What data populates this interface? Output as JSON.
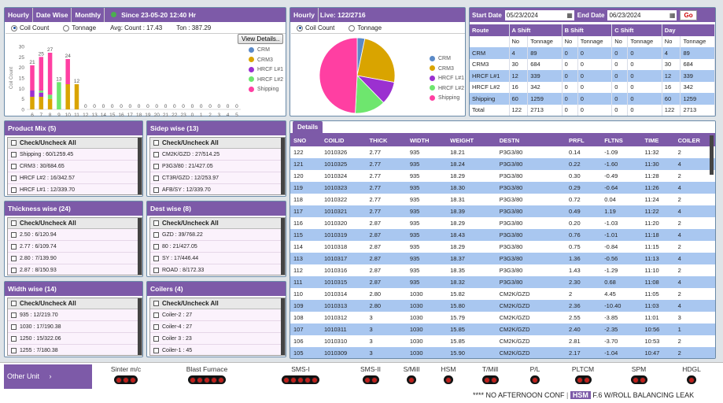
{
  "summary": {
    "tabs": [
      "Hourly",
      "Date Wise",
      "Monthly"
    ],
    "since": "Since 23-05-20 12:40 Hr",
    "coil_count_label": "Coil Count",
    "tonnage_label": "Tonnage",
    "avg_count": "Avg: Count : 17.43",
    "ton": "Ton : 387.29",
    "view_details": "View Details..",
    "legend": [
      {
        "name": "CRM",
        "color": "#5b8ac7"
      },
      {
        "name": "CRM3",
        "color": "#d9a400"
      },
      {
        "name": "HRCF L#1",
        "color": "#9b30d0"
      },
      {
        "name": "HRCF L#2",
        "color": "#6ee66e"
      },
      {
        "name": "Shipping",
        "color": "#ff3fa2"
      }
    ]
  },
  "chart_data": [
    {
      "type": "bar",
      "stacked": true,
      "ylabel": "Coil Count",
      "ylim": [
        0,
        30
      ],
      "yticks": [
        0,
        5,
        10,
        15,
        20,
        25,
        30
      ],
      "categories": [
        "6",
        "7",
        "8",
        "9",
        "10",
        "11",
        "12",
        "13",
        "14",
        "15",
        "16",
        "17",
        "18",
        "19",
        "20",
        "21",
        "22",
        "23",
        "0",
        "1",
        "2",
        "3",
        "4",
        "5"
      ],
      "labels": [
        21,
        25,
        27,
        13,
        24,
        12,
        0,
        0,
        0,
        0,
        0,
        0,
        0,
        0,
        0,
        0,
        0,
        0,
        0,
        0,
        0,
        0,
        0,
        0
      ],
      "series": [
        {
          "name": "CRM",
          "values": [
            0,
            0,
            0,
            0,
            0,
            0,
            0,
            0,
            0,
            0,
            0,
            0,
            0,
            0,
            0,
            0,
            0,
            0,
            0,
            0,
            0,
            0,
            0,
            0
          ]
        },
        {
          "name": "CRM3",
          "values": [
            6,
            6,
            5,
            0,
            12,
            12,
            0,
            0,
            0,
            0,
            0,
            0,
            0,
            0,
            0,
            0,
            0,
            0,
            0,
            0,
            0,
            0,
            0,
            0
          ]
        },
        {
          "name": "HRCF L#1",
          "values": [
            3,
            2,
            0,
            0,
            0,
            0,
            0,
            0,
            0,
            0,
            0,
            0,
            0,
            0,
            0,
            0,
            0,
            0,
            0,
            0,
            0,
            0,
            0,
            0
          ]
        },
        {
          "name": "HRCF L#2",
          "values": [
            0,
            1,
            2,
            13,
            0,
            0,
            0,
            0,
            0,
            0,
            0,
            0,
            0,
            0,
            0,
            0,
            0,
            0,
            0,
            0,
            0,
            0,
            0,
            0
          ]
        },
        {
          "name": "Shipping",
          "values": [
            12,
            16,
            20,
            0,
            12,
            0,
            0,
            0,
            0,
            0,
            0,
            0,
            0,
            0,
            0,
            0,
            0,
            0,
            0,
            0,
            0,
            0,
            0,
            0
          ]
        }
      ]
    },
    {
      "type": "pie",
      "slices": [
        {
          "name": "CRM",
          "value": 4
        },
        {
          "name": "CRM3",
          "value": 30
        },
        {
          "name": "HRCF L#1",
          "value": 12
        },
        {
          "name": "HRCF L#2",
          "value": 16
        },
        {
          "name": "Shipping",
          "value": 60
        }
      ]
    }
  ],
  "live": {
    "tabs": [
      "Hourly",
      "Live: 122/2716"
    ],
    "coil_count_label": "Coil Count",
    "tonnage_label": "Tonnage"
  },
  "shift": {
    "start_label": "Start Date",
    "start_value": "05/23/2024",
    "end_label": "End Date",
    "end_value": "06/23/2024",
    "go": "Go",
    "head1": [
      "Route",
      "A Shift",
      "B Shift",
      "C Shift",
      "Day"
    ],
    "head2": [
      "",
      "No",
      "Tonnage",
      "No",
      "Tonnage",
      "No",
      "Tonnage",
      "No",
      "Tonnage"
    ],
    "rows": [
      [
        "CRM",
        "4",
        "89",
        "0",
        "0",
        "0",
        "0",
        "4",
        "89"
      ],
      [
        "CRM3",
        "30",
        "684",
        "0",
        "0",
        "0",
        "0",
        "30",
        "684"
      ],
      [
        "HRCF L#1",
        "12",
        "339",
        "0",
        "0",
        "0",
        "0",
        "12",
        "339"
      ],
      [
        "HRCF L#2",
        "16",
        "342",
        "0",
        "0",
        "0",
        "0",
        "16",
        "342"
      ],
      [
        "Shipping",
        "60",
        "1259",
        "0",
        "0",
        "0",
        "0",
        "60",
        "1259"
      ],
      [
        "Total",
        "122",
        "2713",
        "0",
        "0",
        "0",
        "0",
        "122",
        "2713"
      ]
    ]
  },
  "filters": {
    "check_all": "Check/Uncheck All",
    "product_mix": {
      "title": "Product Mix (5)",
      "items": [
        "Shipping : 60/1259.45",
        "CRM3 : 30/684.65",
        "HRCF L#2 : 16/342.57",
        "HRCF L#1 : 12/339.70"
      ]
    },
    "sidep": {
      "title": "Sidep wise (13)",
      "items": [
        "CM2K/GZD : 27/514.25",
        "P3G3/80 : 21/427.05",
        "CT3R/GZD : 12/253.97",
        "AFB/SY : 12/339.70"
      ]
    },
    "thickness": {
      "title": "Thickness wise (24)",
      "items": [
        "2.50 : 6/120.94",
        "2.77 : 6/109.74",
        "2.80 : 7/139.90",
        "2.87 : 8/150.93"
      ]
    },
    "dest": {
      "title": "Dest wise (8)",
      "items": [
        "GZD : 39/768.22",
        "80 : 21/427.05",
        "SY : 17/446.44",
        "ROAD : 8/172.33"
      ]
    },
    "width": {
      "title": "Width wise (14)",
      "items": [
        "935 : 12/219.70",
        "1030 : 17/190.38",
        "1250 : 15/322.06",
        "1255 : 7/180.38"
      ]
    },
    "coilers": {
      "title": "Coilers (4)",
      "items": [
        "Coiler-2 : 27",
        "Coiler-4 : 27",
        "Coiler 3 : 23",
        "Coiler-1 : 45"
      ]
    }
  },
  "details": {
    "tab": "Details",
    "columns": [
      "SNO",
      "COILID",
      "THICK",
      "WIDTH",
      "WEIGHT",
      "DESTN",
      "PRFL",
      "FLTNS",
      "TIME",
      "COILER"
    ],
    "rows": [
      [
        "122",
        "1010326",
        "2.77",
        "935",
        "18.21",
        "P3G3/80",
        "0.14",
        "-1.09",
        "11:32",
        "2"
      ],
      [
        "121",
        "1010325",
        "2.77",
        "935",
        "18.24",
        "P3G3/80",
        "0.22",
        "-1.60",
        "11:30",
        "4"
      ],
      [
        "120",
        "1010324",
        "2.77",
        "935",
        "18.29",
        "P3G3/80",
        "0.30",
        "-0.49",
        "11:28",
        "2"
      ],
      [
        "119",
        "1010323",
        "2.77",
        "935",
        "18.30",
        "P3G3/80",
        "0.29",
        "-0.64",
        "11:26",
        "4"
      ],
      [
        "118",
        "1010322",
        "2.77",
        "935",
        "18.31",
        "P3G3/80",
        "0.72",
        "0.04",
        "11:24",
        "2"
      ],
      [
        "117",
        "1010321",
        "2.77",
        "935",
        "18.39",
        "P3G3/80",
        "0.49",
        "1.19",
        "11:22",
        "4"
      ],
      [
        "116",
        "1010320",
        "2.87",
        "935",
        "18.29",
        "P3G3/80",
        "0.20",
        "-1.03",
        "11:20",
        "2"
      ],
      [
        "115",
        "1010319",
        "2.87",
        "935",
        "18.43",
        "P3G3/80",
        "0.76",
        "-1.01",
        "11:18",
        "4"
      ],
      [
        "114",
        "1010318",
        "2.87",
        "935",
        "18.29",
        "P3G3/80",
        "0.75",
        "-0.84",
        "11:15",
        "2"
      ],
      [
        "113",
        "1010317",
        "2.87",
        "935",
        "18.37",
        "P3G3/80",
        "1.36",
        "-0.56",
        "11:13",
        "4"
      ],
      [
        "112",
        "1010316",
        "2.87",
        "935",
        "18.35",
        "P3G3/80",
        "1.43",
        "-1.29",
        "11:10",
        "2"
      ],
      [
        "111",
        "1010315",
        "2.87",
        "935",
        "18.32",
        "P3G3/80",
        "2.30",
        "0.68",
        "11:08",
        "4"
      ],
      [
        "110",
        "1010314",
        "2.80",
        "1030",
        "15.82",
        "CM2K/GZD",
        "2",
        "4.45",
        "11:05",
        "2"
      ],
      [
        "109",
        "1010313",
        "2.80",
        "1030",
        "15.80",
        "CM2K/GZD",
        "2.36",
        "-10.40",
        "11:03",
        "4"
      ],
      [
        "108",
        "1010312",
        "3",
        "1030",
        "15.79",
        "CM2K/GZD",
        "2.55",
        "-3.85",
        "11:01",
        "3"
      ],
      [
        "107",
        "1010311",
        "3",
        "1030",
        "15.85",
        "CM2K/GZD",
        "2.40",
        "-2.35",
        "10:56",
        "1"
      ],
      [
        "106",
        "1010310",
        "3",
        "1030",
        "15.85",
        "CM2K/GZD",
        "2.81",
        "-3.70",
        "10:53",
        "2"
      ],
      [
        "105",
        "1010309",
        "3",
        "1030",
        "15.90",
        "CM2K/GZD",
        "2.17",
        "-1.04",
        "10:47",
        "2"
      ],
      [
        "104",
        "1010308",
        "3",
        "1030",
        "15.90",
        "CM2K/GZD",
        "2.88",
        "-0.61",
        "10:45",
        "3"
      ]
    ]
  },
  "units": {
    "other": "Other Unit",
    "items": [
      {
        "name": "Sinter m/c",
        "lights": 3
      },
      {
        "name": "Blast Furnace",
        "lights": 5
      },
      {
        "name": "SMS-I",
        "lights": 5
      },
      {
        "name": "SMS-II",
        "lights": 2
      },
      {
        "name": "S/Mill",
        "lights": 1
      },
      {
        "name": "HSM",
        "lights": 1
      },
      {
        "name": "T/Mill",
        "lights": 2
      },
      {
        "name": "P/L",
        "lights": 1
      },
      {
        "name": "PLTCM",
        "lights": 2
      },
      {
        "name": "SPM",
        "lights": 2
      },
      {
        "name": "HDGL",
        "lights": 1
      }
    ],
    "ticker_prefix": "**** NO AFTERNOON CONF",
    "ticker_tag": "HSM",
    "ticker_text": "F.6 W/ROLL BALANCING LEAK"
  }
}
